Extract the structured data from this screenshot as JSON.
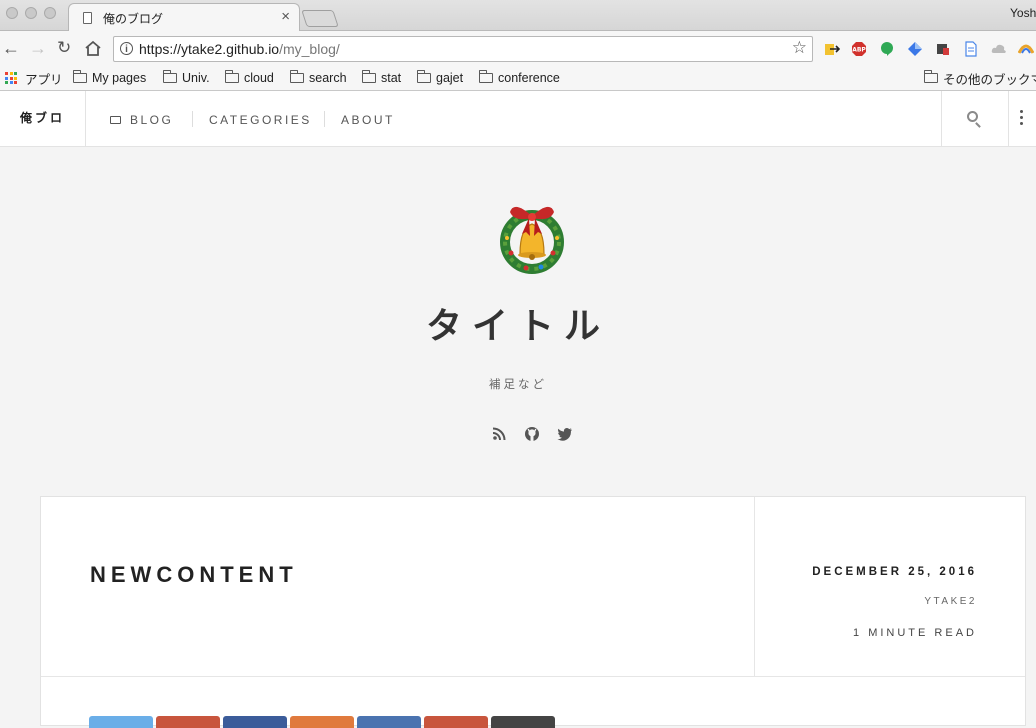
{
  "browser": {
    "tab_title": "俺のブログ",
    "tab_close": "×",
    "profile_name": "Yosh",
    "url_host": "https://ytake2.github.io",
    "url_path": "/my_blog/",
    "bookmarks": [
      "アプリ",
      "My pages",
      "Univ.",
      "cloud",
      "search",
      "stat",
      "gajet",
      "conference"
    ],
    "other_bookmarks": "その他のブックマ"
  },
  "site": {
    "brand": "俺ブロ",
    "nav": [
      "BLOG",
      "CATEGORIES",
      "ABOUT"
    ],
    "title": "タイトル",
    "description": "補足など",
    "social_icons": [
      "rss-icon",
      "github-icon",
      "twitter-icon"
    ]
  },
  "post": {
    "title": "NEWCONTENT",
    "date": "DECEMBER 25, 2016",
    "author": "YTAKE2",
    "read_time": "1 MINUTE READ",
    "share_colors": [
      "#6aaee8",
      "#c8553d",
      "#3b5c9a",
      "#e07a3d",
      "#4a73b0",
      "#c8553d",
      "#444444"
    ]
  },
  "colors": {
    "accent_text": "#222222",
    "page_bg": "#f4f4f4"
  }
}
